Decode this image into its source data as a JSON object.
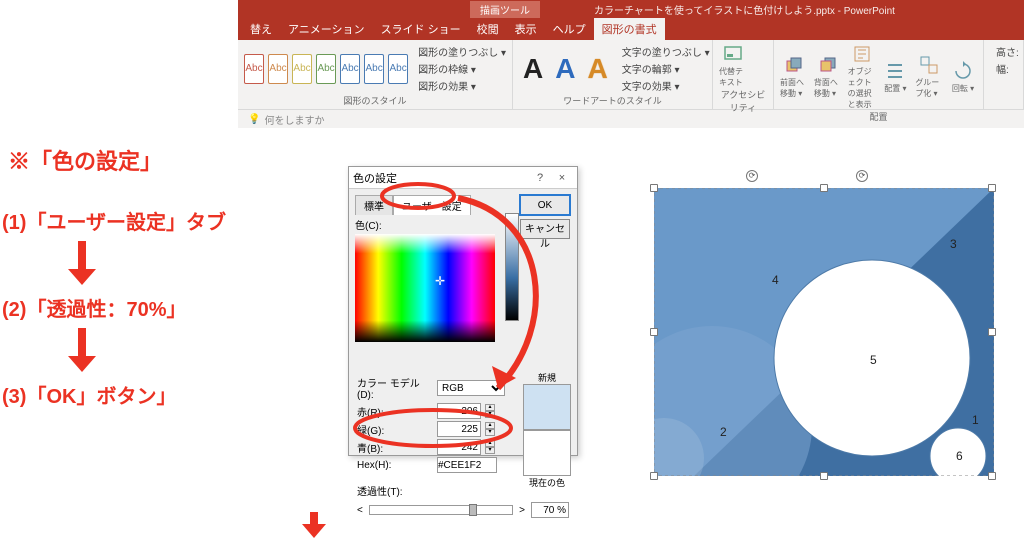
{
  "app": {
    "drawing_tools_tab": "描画ツール",
    "file_name": "カラーチャートを使ってイラストに色付けしよう.pptx - PowerPoint",
    "tell_me": "何をしますか"
  },
  "ribbon_tabs": {
    "t0": "替え",
    "t1": "アニメーション",
    "t2": "スライド ショー",
    "t3": "校閲",
    "t4": "表示",
    "t5": "ヘルプ",
    "t6": "図形の書式"
  },
  "ribbon": {
    "abc": "Abc",
    "fill": "図形の塗りつぶし ▾",
    "outline": "図形の枠線 ▾",
    "effects": "図形の効果 ▾",
    "group_style": "図形のスタイル",
    "wa_fill": "文字の塗りつぶし ▾",
    "wa_outline": "文字の輪郭 ▾",
    "wa_effects": "文字の効果 ▾",
    "group_wordart": "ワードアートのスタイル",
    "alt_text": "代替テキスト",
    "group_acc": "アクセシビリティ",
    "bring_fwd": "前面へ移動 ▾",
    "send_back": "背面へ移動 ▾",
    "sel_pane": "オブジェクトの選択と表示",
    "align": "配置 ▾",
    "group": "グループ化 ▾",
    "rotate": "回転 ▾",
    "group_arrange": "配置",
    "height": "高さ:",
    "width": "幅:"
  },
  "instr": {
    "hdr": "※「色の設定」",
    "s1": "(1)「ユーザー設定」タブ",
    "s2": "(2)「透過性：70%」",
    "s3": "(3)「OK」ボタン」"
  },
  "dlg": {
    "title": "色の設定",
    "help": "?",
    "close": "×",
    "tab_standard": "標準",
    "tab_custom": "ユーザー設定",
    "ok": "OK",
    "cancel": "キャンセル",
    "colors_label": "色(C):",
    "model_label": "カラー モデル(D):",
    "model_value": "RGB",
    "r_label": "赤(R):",
    "r_value": "206",
    "g_label": "緑(G):",
    "g_value": "225",
    "b_label": "青(B):",
    "b_value": "242",
    "hex_label": "Hex(H):",
    "hex_value": "#CEE1F2",
    "trans_label": "透過性(T):",
    "trans_lt": "<",
    "trans_gt": ">",
    "trans_value": "70 %",
    "new_label": "新規",
    "cur_label": "現在の色"
  },
  "canvas": {
    "n1": "1",
    "n2": "2",
    "n3": "3",
    "n4": "4",
    "n5": "5",
    "n6": "6",
    "rot": "⟳"
  },
  "style_colors": [
    "#c55a4a",
    "#ce8a4e",
    "#c9b555",
    "#6a9a56",
    "#4a7bb3",
    "#4a7bb3",
    "#4a7bb3"
  ]
}
